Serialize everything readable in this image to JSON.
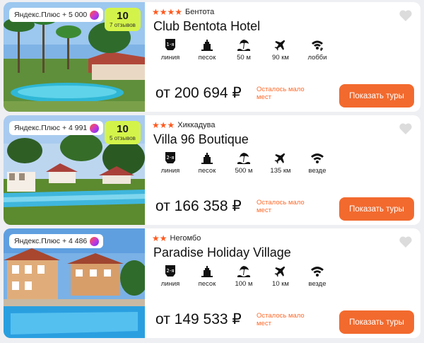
{
  "colors": {
    "accent": "#f26a2e",
    "rating_bg": "#d4f34a",
    "stars": "#ff5a1f",
    "scarcity": "#ff6a2a"
  },
  "hotels": [
    {
      "plus_label": "Яндекс.Плюс + 5 000",
      "rating": "10",
      "reviews": "7 отзывов",
      "stars_count": 4,
      "stars": "★★★★",
      "location": "Бентота",
      "name": "Club Bentota Hotel",
      "features": [
        {
          "icon": "beach-line-1-icon",
          "label": "линия"
        },
        {
          "icon": "sand-beach-icon",
          "label": "песок"
        },
        {
          "icon": "sea-distance-icon",
          "label": "50 м"
        },
        {
          "icon": "airport-distance-icon",
          "label": "90 км"
        },
        {
          "icon": "wifi-paid-icon",
          "label": "лобби"
        }
      ],
      "price": "от 200 694 ₽",
      "scarcity": "Осталось мало мест",
      "button": "Показать туры"
    },
    {
      "plus_label": "Яндекс.Плюс + 4 991",
      "rating": "10",
      "reviews": "5 отзывов",
      "stars_count": 3,
      "stars": "★★★",
      "location": "Хиккадува",
      "name": "Villa 96 Boutique",
      "features": [
        {
          "icon": "beach-line-2-icon",
          "label": "линия"
        },
        {
          "icon": "sand-beach-icon",
          "label": "песок"
        },
        {
          "icon": "sea-distance-icon",
          "label": "500 м"
        },
        {
          "icon": "airport-distance-icon",
          "label": "135 км"
        },
        {
          "icon": "wifi-icon",
          "label": "везде"
        }
      ],
      "price": "от 166 358 ₽",
      "scarcity": "Осталось мало мест",
      "button": "Показать туры"
    },
    {
      "plus_label": "Яндекс.Плюс + 4 486",
      "stars_count": 2,
      "stars": "★★",
      "location": "Негомбо",
      "name": "Paradise Holiday Village",
      "features": [
        {
          "icon": "beach-line-2-icon",
          "label": "линия"
        },
        {
          "icon": "sand-beach-icon",
          "label": "песок"
        },
        {
          "icon": "sea-distance-icon",
          "label": "100 м"
        },
        {
          "icon": "airport-distance-icon",
          "label": "10 км"
        },
        {
          "icon": "wifi-icon",
          "label": "везде"
        }
      ],
      "price": "от 149 533 ₽",
      "scarcity": "Осталось мало мест",
      "button": "Показать туры"
    }
  ]
}
